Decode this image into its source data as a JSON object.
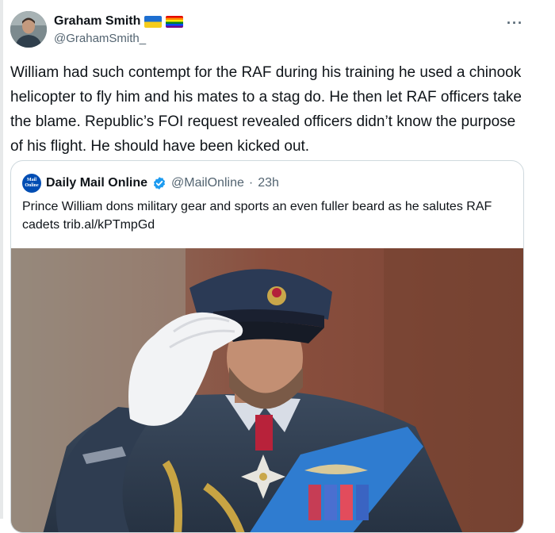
{
  "tweet": {
    "author": {
      "name": "Graham Smith",
      "handle": "@GrahamSmith_",
      "badges": [
        "ukraine-flag-icon",
        "rainbow-flag-icon"
      ]
    },
    "text": "William had such contempt for the RAF during his training he used a chinook helicopter to fly him and his mates to a stag do. He then let RAF officers take the blame. Republic’s FOI request revealed officers didn’t know the purpose of his flight. He should have been kicked out.",
    "more_label": "···"
  },
  "quote": {
    "logo_text": [
      "Mail",
      "Online"
    ],
    "name": "Daily Mail Online",
    "handle": "@MailOnline",
    "separator": "·",
    "time": "23h",
    "text": "Prince William dons military gear and sports an even fuller beard as he salutes RAF cadets trib.al/kPTmpGd"
  },
  "colors": {
    "text": "#0f1419",
    "secondary": "#536471",
    "border": "#cfd9de",
    "verified": "#1d9bf0",
    "mail_blue": "#004db3"
  }
}
